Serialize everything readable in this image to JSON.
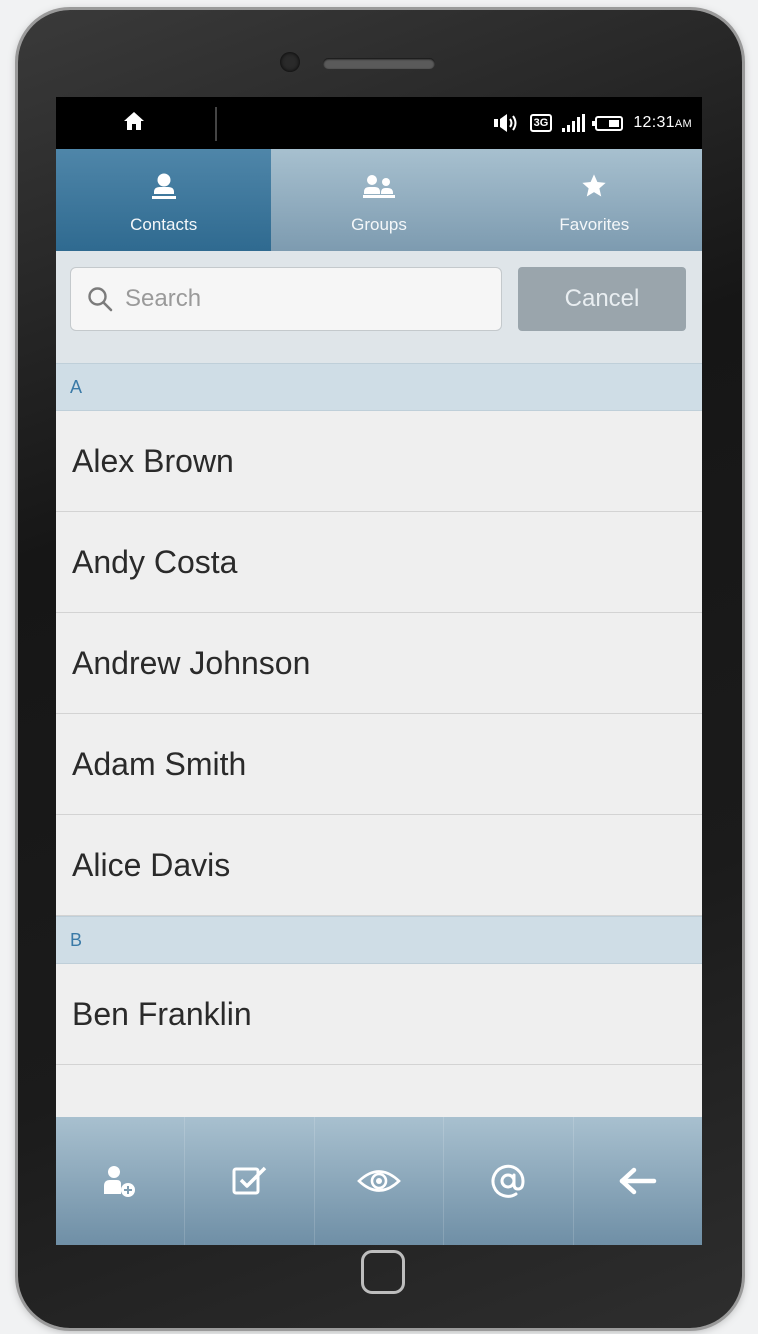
{
  "status_bar": {
    "time": "12:31",
    "ampm": "AM",
    "network": "3G"
  },
  "tabs": [
    {
      "label": "Contacts",
      "icon": "person-icon",
      "active": true
    },
    {
      "label": "Groups",
      "icon": "group-icon",
      "active": false
    },
    {
      "label": "Favorites",
      "icon": "star-icon",
      "active": false
    }
  ],
  "search": {
    "placeholder": "Search",
    "value": "",
    "cancel_label": "Cancel"
  },
  "sections": [
    {
      "letter": "A",
      "contacts": [
        "Alex Brown",
        "Andy Costa",
        "Andrew Johnson",
        "Adam Smith",
        "Alice Davis"
      ]
    },
    {
      "letter": "B",
      "contacts": [
        "Ben Franklin"
      ]
    }
  ],
  "toolbar": [
    {
      "icon": "add-contact-icon"
    },
    {
      "icon": "checkbox-icon"
    },
    {
      "icon": "eye-icon"
    },
    {
      "icon": "at-sign-icon"
    },
    {
      "icon": "back-arrow-icon"
    }
  ],
  "colors": {
    "tab_active": "#2f6a90",
    "section_header_bg": "#cfdde6",
    "section_header_text": "#3a7aa7",
    "cancel_button": "#9aa5ac"
  }
}
